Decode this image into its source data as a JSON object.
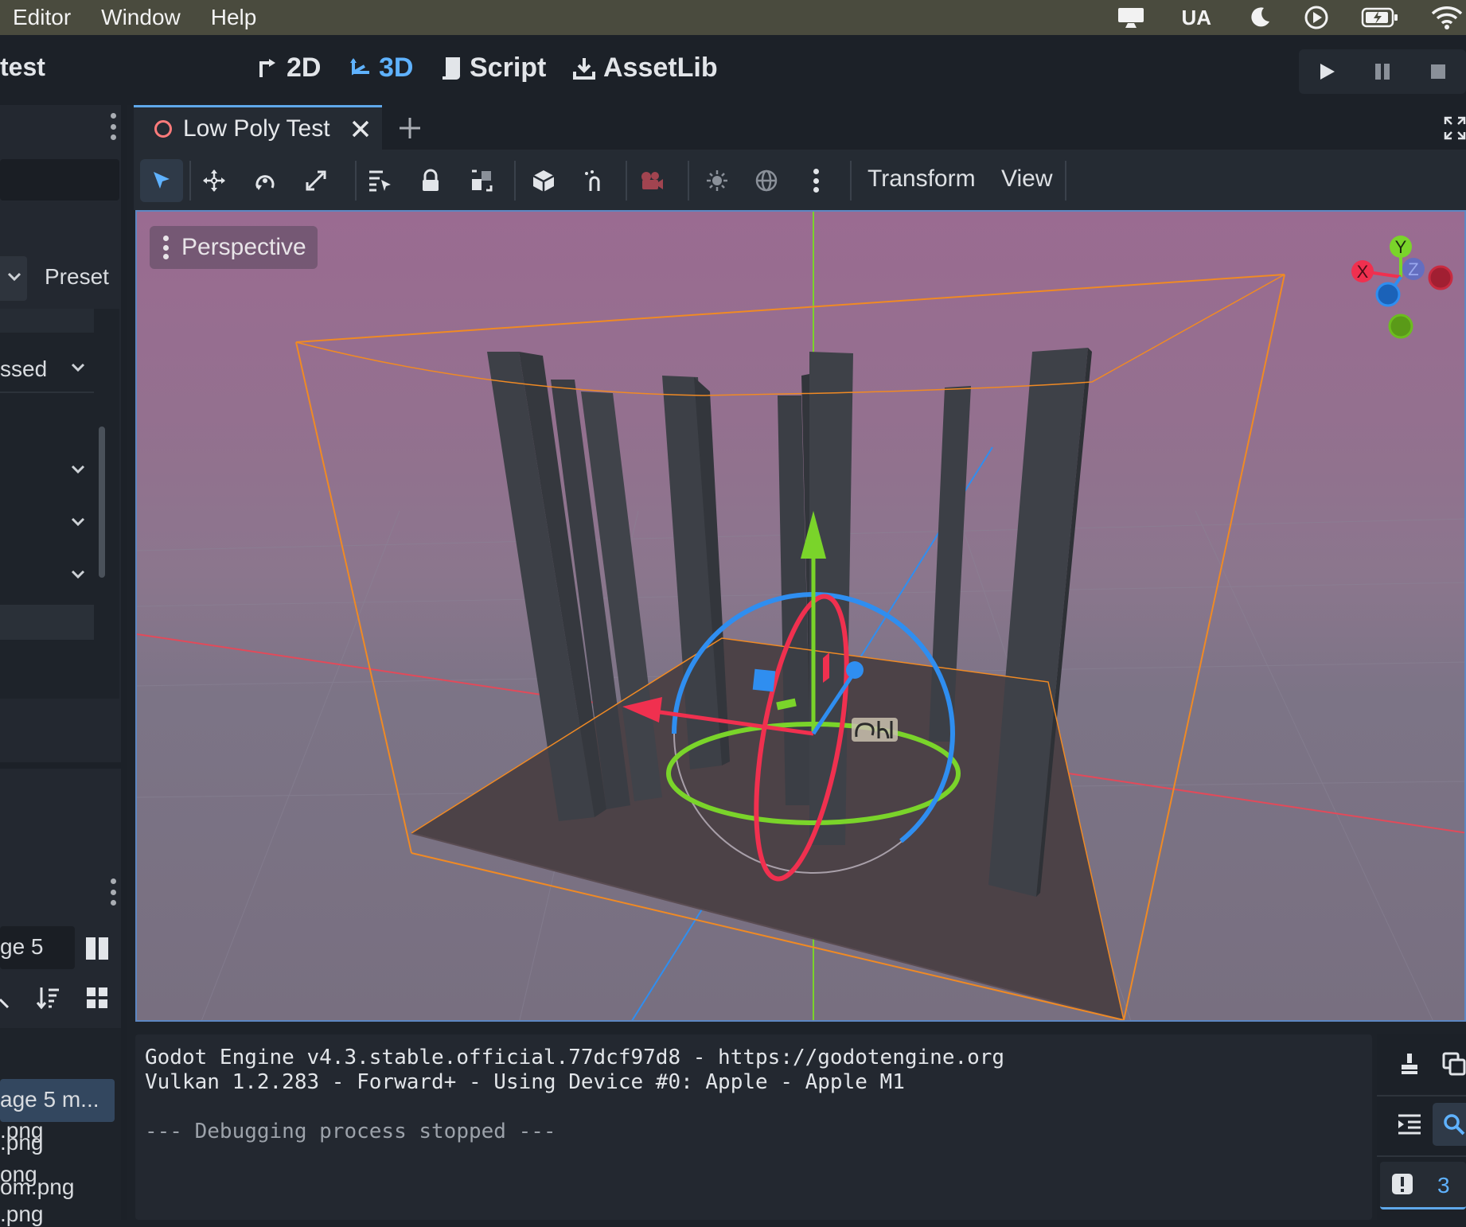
{
  "menubar": {
    "items": [
      "Editor",
      "Window",
      "Help"
    ],
    "input_source": "UA"
  },
  "topbar": {
    "project_name": "test",
    "screens": [
      {
        "label": "2D",
        "icon": "2d-icon",
        "active": false
      },
      {
        "label": "3D",
        "icon": "3d-icon",
        "active": true
      },
      {
        "label": "Script",
        "icon": "script-icon",
        "active": false
      },
      {
        "label": "AssetLib",
        "icon": "assetlib-icon",
        "active": false
      }
    ]
  },
  "left_dock": {
    "preset_label": "Preset",
    "dropdown_value": "ssed",
    "filesystem": {
      "path_value": "ge 5",
      "files": [
        "age 5 m...",
        ".png",
        "om.png",
        ".png",
        "ong",
        ".png"
      ]
    }
  },
  "scene_tab": {
    "label": "Low Poly Test"
  },
  "toolbar": {
    "transform_label": "Transform",
    "view_label": "View"
  },
  "viewport": {
    "perspective_label": "Perspective",
    "gizmo_axes": {
      "x": "X",
      "y": "Y",
      "z": "Z"
    }
  },
  "output": {
    "lines": [
      "Godot Engine v4.3.stable.official.77dcf97d8 - https://godotengine.org",
      "Vulkan 1.2.283 - Forward+ - Using Device #0: Apple - Apple M1",
      "",
      "--- Debugging process stopped ---"
    ],
    "error_count": "3"
  },
  "colors": {
    "accent": "#5fb2ff",
    "x_axis": "#f0304f",
    "y_axis": "#7ad42a",
    "z_axis": "#2f8ef0",
    "selection": "#f08a24"
  }
}
